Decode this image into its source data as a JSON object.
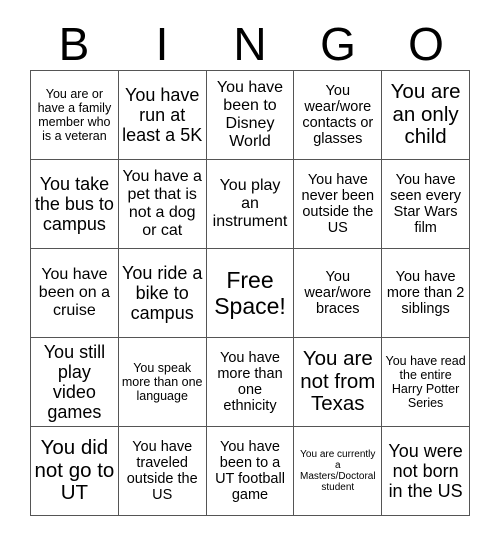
{
  "card": {
    "title_letters": [
      "B",
      "I",
      "N",
      "G",
      "O"
    ],
    "columns": 5,
    "rows": 5,
    "free_space_position": "center",
    "colors": {
      "background": "#ffffff",
      "text": "#000000",
      "grid_line": "#555555"
    },
    "cells": [
      [
        {
          "text": "You are or have a family member who is a veteran",
          "size": "s"
        },
        {
          "text": "You have run at least a 5K",
          "size": "xl"
        },
        {
          "text": "You have been to Disney World",
          "size": "l"
        },
        {
          "text": "You wear/wore contacts or glasses",
          "size": "m"
        },
        {
          "text": "You are an only child",
          "size": "xxl"
        }
      ],
      [
        {
          "text": "You take the bus to campus",
          "size": "xl"
        },
        {
          "text": "You have a pet that is not a dog or cat",
          "size": "l"
        },
        {
          "text": "You play an instrument",
          "size": "l"
        },
        {
          "text": "You have never been outside the US",
          "size": "m"
        },
        {
          "text": "You have seen every Star Wars film",
          "size": "m"
        }
      ],
      [
        {
          "text": "You have been on a cruise",
          "size": "l"
        },
        {
          "text": "You ride a bike to campus",
          "size": "xl"
        },
        {
          "text": "Free Space!",
          "size": "free"
        },
        {
          "text": "You wear/wore braces",
          "size": "m"
        },
        {
          "text": "You have more than 2 siblings",
          "size": "m"
        }
      ],
      [
        {
          "text": "You still play video games",
          "size": "xl"
        },
        {
          "text": "You speak more than one language",
          "size": "s"
        },
        {
          "text": "You have more than one ethnicity",
          "size": "m"
        },
        {
          "text": "You are not from Texas",
          "size": "xxl"
        },
        {
          "text": "You have read the entire Harry Potter Series",
          "size": "s"
        }
      ],
      [
        {
          "text": "You did not go to UT",
          "size": "xxl"
        },
        {
          "text": "You have traveled outside the US",
          "size": "m"
        },
        {
          "text": "You have been to a UT football game",
          "size": "m"
        },
        {
          "text": "You are currently a Masters/Doctoral student",
          "size": "xs"
        },
        {
          "text": "You were not born in the US",
          "size": "xl"
        }
      ]
    ]
  }
}
